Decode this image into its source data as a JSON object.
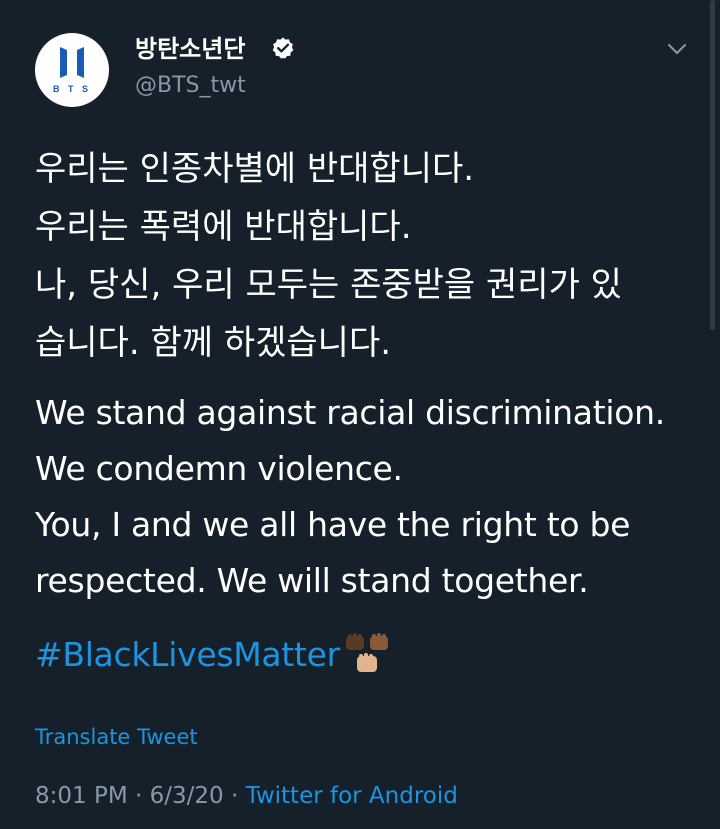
{
  "tweet": {
    "display_name": "방탄소년단",
    "handle": "@BTS_twt",
    "avatar_text": "B T S",
    "verified_icon": "verified-badge-icon",
    "menu_icon": "chevron-down-icon",
    "korean_lines": [
      "우리는 인종차별에 반대합니다.",
      "우리는 폭력에 반대합니다.",
      "나, 당신, 우리 모두는 존중받을 권리가 있",
      "습니다. 함께 하겠습니다."
    ],
    "english_lines": [
      "We stand against racial discrimination.",
      "We condemn violence.",
      "You, I and we all have the right to be",
      "respected. We will stand together."
    ],
    "hashtag": "#BlackLivesMatter",
    "emoji_icon": "raised-fists-icon",
    "translate_label": "Translate Tweet",
    "time": "8:01 PM",
    "separator": "·",
    "date": "6/3/20",
    "source": "Twitter for Android"
  },
  "colors": {
    "background": "#15202b",
    "text_primary": "#ffffff",
    "text_secondary": "#8899a6",
    "link": "#1b95e0",
    "verified": "#ffffff",
    "avatar_logo": "#1a5bb8"
  }
}
